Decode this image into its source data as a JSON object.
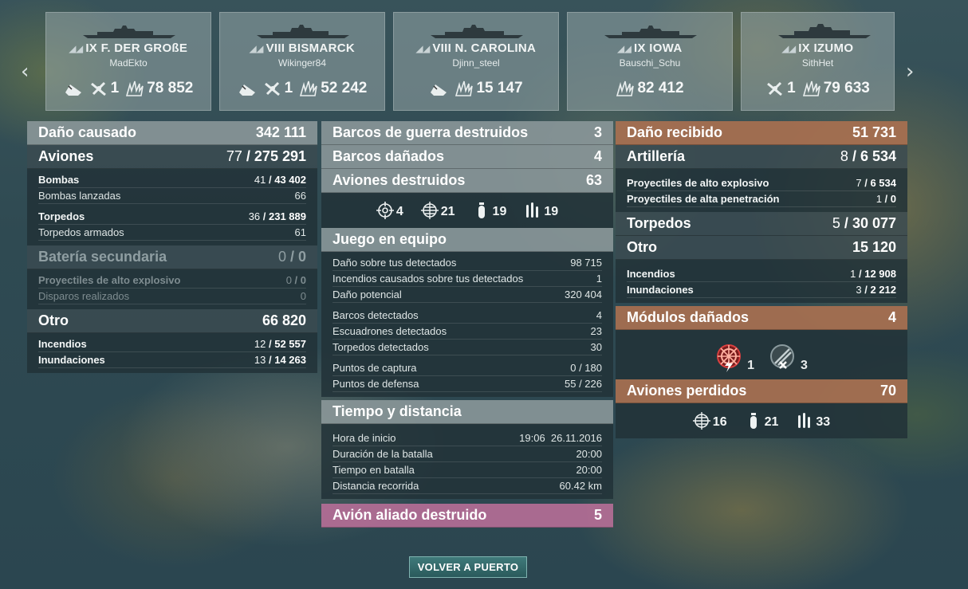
{
  "ships": [
    {
      "tier_name": "IX F. DER GROßE",
      "player": "MadEkto",
      "stats": [
        {
          "icon": "spotted-icon",
          "value": ""
        },
        {
          "icon": "plane-kill-icon",
          "value": "1"
        },
        {
          "icon": "explosion-icon",
          "value": "78 852"
        }
      ]
    },
    {
      "tier_name": "VIII BISMARCK",
      "player": "Wikinger84",
      "stats": [
        {
          "icon": "spotted-icon",
          "value": ""
        },
        {
          "icon": "plane-kill-icon",
          "value": "1"
        },
        {
          "icon": "explosion-icon",
          "value": "52 242"
        }
      ]
    },
    {
      "tier_name": "VIII N. CAROLINA",
      "player": "Djinn_steel",
      "stats": [
        {
          "icon": "spotted-icon",
          "value": ""
        },
        {
          "icon": "explosion-icon",
          "value": "15 147"
        }
      ]
    },
    {
      "tier_name": "IX IOWA",
      "player": "Bauschi_Schu",
      "stats": [
        {
          "icon": "explosion-icon",
          "value": "82 412"
        }
      ]
    },
    {
      "tier_name": "IX IZUMO",
      "player": "SithHet",
      "stats": [
        {
          "icon": "plane-kill-icon",
          "value": "1"
        },
        {
          "icon": "explosion-icon",
          "value": "79 633"
        }
      ]
    }
  ],
  "left": {
    "dano_causado": {
      "label": "Daño causado",
      "value": "342 111"
    },
    "aviones": {
      "label": "Aviones",
      "value_a": "77",
      "value_b": "275 291"
    },
    "bombas": {
      "label": "Bombas",
      "value_a": "41",
      "value_b": "43 402"
    },
    "bombas_lanzadas": {
      "label": "Bombas lanzadas",
      "value": "66"
    },
    "torpedos": {
      "label": "Torpedos",
      "value_a": "36",
      "value_b": "231 889"
    },
    "torpedos_armados": {
      "label": "Torpedos armados",
      "value": "61"
    },
    "bateria": {
      "label": "Batería secundaria",
      "value_a": "0",
      "value_b": "0"
    },
    "proyectiles_he": {
      "label": "Proyectiles de alto explosivo",
      "value_a": "0",
      "value_b": "0"
    },
    "disparos": {
      "label": "Disparos realizados",
      "value": "0"
    },
    "otro": {
      "label": "Otro",
      "value": "66 820"
    },
    "incendios": {
      "label": "Incendios",
      "value_a": "12",
      "value_b": "52 557"
    },
    "inundaciones": {
      "label": "Inundaciones",
      "value_a": "13",
      "value_b": "14 263"
    }
  },
  "mid": {
    "barcos_destruidos": {
      "label": "Barcos de guerra destruidos",
      "value": "3"
    },
    "barcos_danados": {
      "label": "Barcos dañados",
      "value": "4"
    },
    "aviones_destruidos": {
      "label": "Aviones destruidos",
      "value": "63"
    },
    "plane_types": [
      {
        "icon": "fighter-icon",
        "value": "4"
      },
      {
        "icon": "fighter-icon",
        "value": "21"
      },
      {
        "icon": "bomber-icon",
        "value": "19"
      },
      {
        "icon": "torpedo-bomber-icon",
        "value": "19"
      }
    ],
    "juego_equipo": {
      "label": "Juego en equipo"
    },
    "team": [
      {
        "label": "Daño sobre tus detectados",
        "value": "98 715"
      },
      {
        "label": "Incendios causados sobre tus detectados",
        "value": "1"
      },
      {
        "label": "Daño potencial",
        "value": "320 404"
      },
      {
        "label": "Barcos detectados",
        "value": "4"
      },
      {
        "label": "Escuadrones detectados",
        "value": "23"
      },
      {
        "label": "Torpedos detectados",
        "value": "30"
      },
      {
        "label": "Puntos de captura",
        "value": "0 / 180"
      },
      {
        "label": "Puntos de defensa",
        "value": "55 / 226"
      }
    ],
    "tiempo": {
      "label": "Tiempo y distancia"
    },
    "time_rows": [
      {
        "label": "Hora de inicio",
        "value": "19:06  26.11.2016"
      },
      {
        "label": "Duración de la batalla",
        "value": "20:00"
      },
      {
        "label": "Tiempo en batalla",
        "value": "20:00"
      },
      {
        "label": "Distancia recorrida",
        "value": "60.42 km"
      }
    ],
    "avion_aliado": {
      "label": "Avión aliado destruido",
      "value": "5"
    }
  },
  "right": {
    "dano_recibido": {
      "label": "Daño recibido",
      "value": "51 731"
    },
    "artilleria": {
      "label": "Artillería",
      "value_a": "8",
      "value_b": "6 534"
    },
    "proy_he": {
      "label": "Proyectiles de alto explosivo",
      "value_a": "7",
      "value_b": "6 534"
    },
    "proy_ap": {
      "label": "Proyectiles de alta penetración",
      "value_a": "1",
      "value_b": "0"
    },
    "torpedos": {
      "label": "Torpedos",
      "value_a": "5",
      "value_b": "30 077"
    },
    "otro": {
      "label": "Otro",
      "value": "15 120"
    },
    "incendios": {
      "label": "Incendios",
      "value_a": "1",
      "value_b": "12 908"
    },
    "inundaciones": {
      "label": "Inundaciones",
      "value_a": "3",
      "value_b": "2 212"
    },
    "modulos": {
      "label": "Módulos dañados",
      "value": "4"
    },
    "module_items": [
      {
        "icon": "steering-gear-icon",
        "value": "1"
      },
      {
        "icon": "aa-gun-icon",
        "value": "3"
      }
    ],
    "aviones_perdidos": {
      "label": "Aviones perdidos",
      "value": "70"
    },
    "lost_types": [
      {
        "icon": "fighter-icon",
        "value": "16"
      },
      {
        "icon": "bomber-icon",
        "value": "21"
      },
      {
        "icon": "torpedo-bomber-icon",
        "value": "33"
      }
    ]
  },
  "button": {
    "label": "VOLVER A PUERTO"
  },
  "colors": {
    "accent_orange": "#a87050",
    "accent_pink": "#b46e96",
    "button": "#2a5a5c"
  }
}
